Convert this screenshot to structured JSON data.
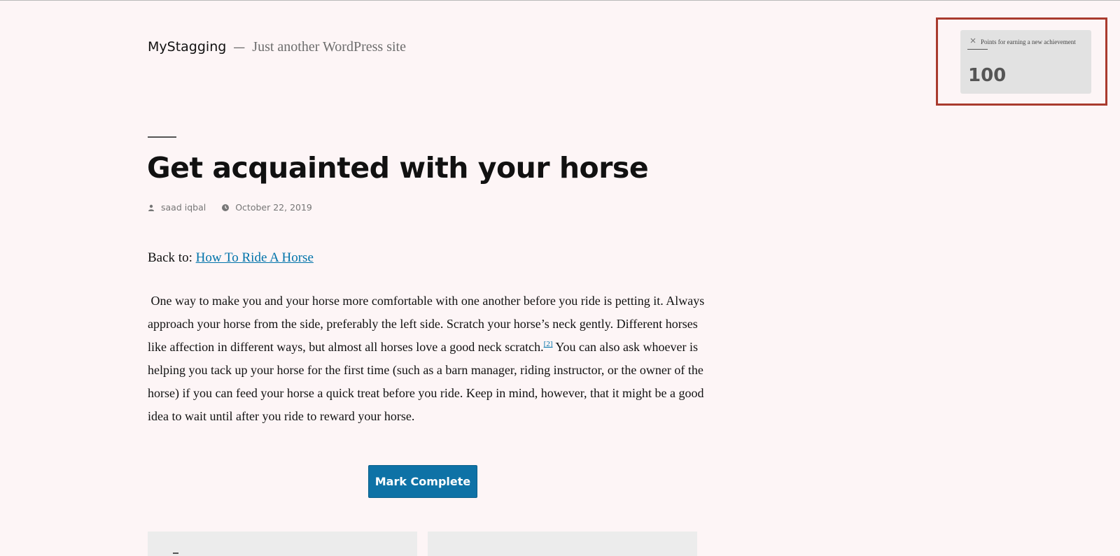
{
  "site": {
    "title": "MyStagging",
    "separator": "—",
    "tagline": "Just another WordPress site"
  },
  "post": {
    "title": "Get acquainted with your horse",
    "author": "saad iqbal",
    "date": "October 22, 2019",
    "back_prefix": "Back to: ",
    "back_link": "How To Ride A Horse",
    "body_part1": "One way to make you and your horse more comfortable with one another before you ride is petting it. Always approach your horse from the side, preferably the left side. Scratch your horse’s neck gently. Different horses like affection in different ways, but almost all horses love a good neck scratch.",
    "footnote": "[2]",
    "body_part2": " You can also ask whoever is helping you tack up your horse for the first time (such as a barn manager, riding instructor, or the owner of the horse) if you can feed your horse a quick treat before you ride. Keep in mind, however, that it might be a good idea to wait until after you ride to reward your horse."
  },
  "actions": {
    "mark_complete": "Mark Complete"
  },
  "notification": {
    "text": "Points for earning a new achievement",
    "points": "100"
  },
  "icons": {
    "author": "person-icon",
    "date": "clock-icon",
    "close": "close-icon"
  },
  "colors": {
    "background": "#fdf5f6",
    "link": "#0073aa",
    "button": "#0e72a6",
    "highlight_frame": "#a93b2e"
  }
}
